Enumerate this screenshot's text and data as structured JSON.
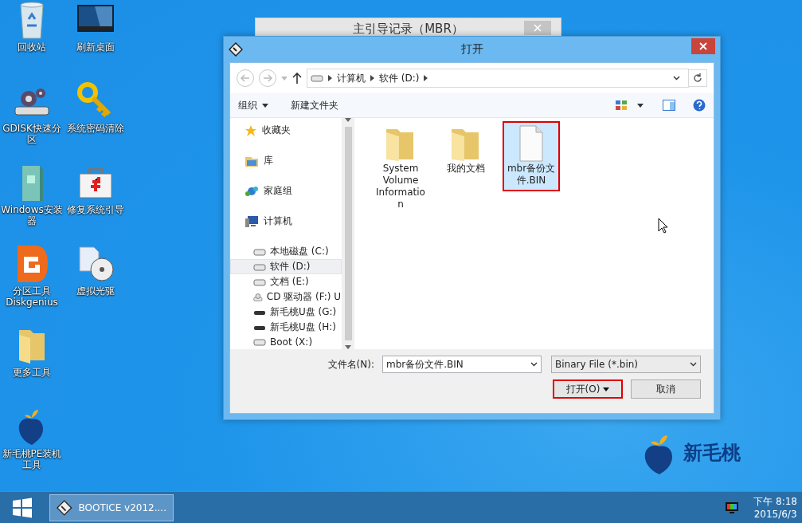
{
  "back_window": {
    "title": "主引导记录（MBR）"
  },
  "desktop_icons": [
    {
      "label": "回收站",
      "kind": "recycle"
    },
    {
      "label": "GDISK快速分区",
      "kind": "gear-drive"
    },
    {
      "label": "Windows安装器",
      "kind": "installer"
    },
    {
      "label": "分区工具 Diskgenius",
      "kind": "partition"
    },
    {
      "label": "更多工具",
      "kind": "folder"
    },
    {
      "label": "新毛桃PE装机工具",
      "kind": "peach"
    },
    {
      "label": "刷新桌面",
      "kind": "screen"
    },
    {
      "label": "系统密码清除",
      "kind": "key"
    },
    {
      "label": "修复系统引导",
      "kind": "aid"
    },
    {
      "label": "虚拟光驱",
      "kind": "disc"
    }
  ],
  "dialog": {
    "title": "打开",
    "path": [
      "计算机",
      "软件 (D:)"
    ],
    "toolbar": {
      "organize": "组织",
      "new_folder": "新建文件夹"
    },
    "nav": [
      {
        "label": "收藏夹",
        "kind": "star"
      },
      {
        "label": "库",
        "kind": "library"
      },
      {
        "label": "家庭组",
        "kind": "homegroup"
      },
      {
        "label": "计算机",
        "kind": "computer",
        "children": [
          {
            "label": "本地磁盘 (C:)",
            "kind": "drive",
            "selected": false
          },
          {
            "label": "软件 (D:)",
            "kind": "drive",
            "selected": true
          },
          {
            "label": "文档 (E:)",
            "kind": "drive",
            "selected": false
          },
          {
            "label": "CD 驱动器 (F:) U",
            "kind": "cd",
            "selected": false
          },
          {
            "label": "新毛桃U盘 (G:)",
            "kind": "usb",
            "selected": false
          },
          {
            "label": "新毛桃U盘 (H:)",
            "kind": "usb",
            "selected": false
          },
          {
            "label": "Boot (X:)",
            "kind": "drive",
            "selected": false
          }
        ]
      }
    ],
    "files": [
      {
        "name": "System Volume Information",
        "kind": "folder",
        "highlighted": false
      },
      {
        "name": "我的文档",
        "kind": "folder",
        "highlighted": false
      },
      {
        "name": "mbr备份文件.BIN",
        "kind": "file",
        "highlighted": true
      }
    ],
    "filename_label": "文件名(N):",
    "filename": "mbr备份文件.BIN",
    "filter": "Binary File (*.bin)",
    "buttons": [
      {
        "label": "打开(O)",
        "kind": "split",
        "highlighted": true
      },
      {
        "label": "取消",
        "kind": "plain",
        "highlighted": false
      }
    ]
  },
  "logo": {
    "text": "新毛桃"
  },
  "taskbar": {
    "tasks": [
      {
        "label": "BOOTICE v2012...."
      }
    ],
    "time": "下午 8:18",
    "date": "2015/6/3"
  }
}
